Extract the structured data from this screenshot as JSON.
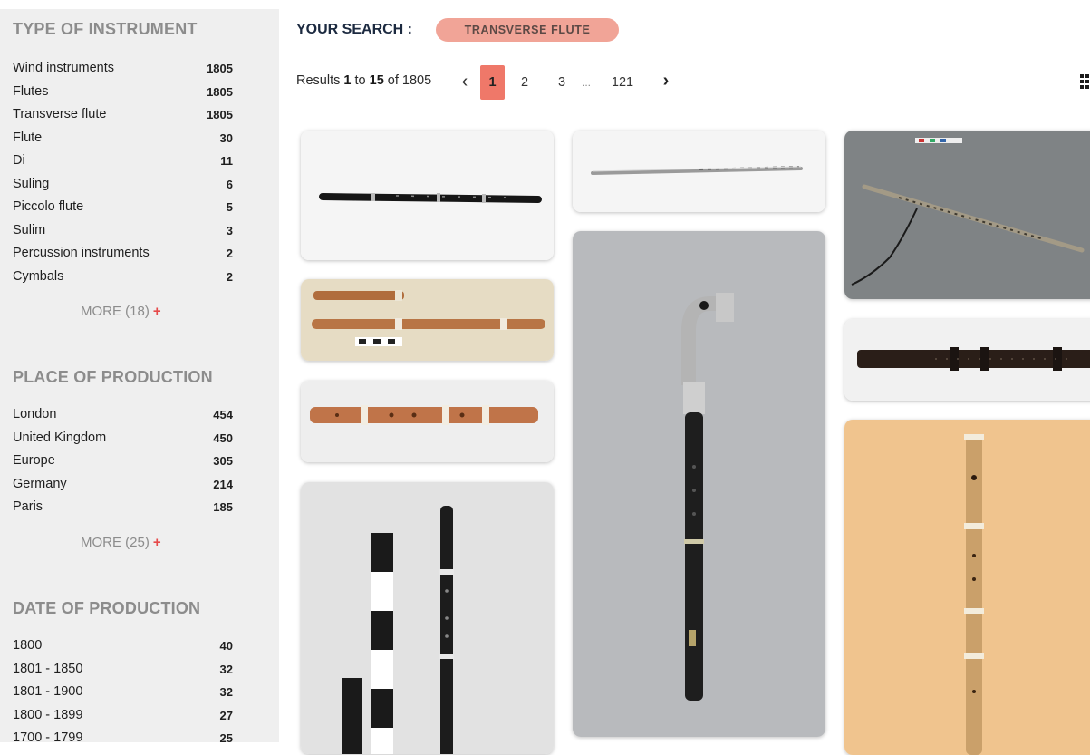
{
  "sidebar": {
    "instrument": {
      "title": "TYPE OF INSTRUMENT",
      "items": [
        {
          "label": "Wind instruments",
          "count": "1805"
        },
        {
          "label": "Flutes",
          "count": "1805"
        },
        {
          "label": "Transverse flute",
          "count": "1805"
        },
        {
          "label": "Flute",
          "count": "30"
        },
        {
          "label": "Di",
          "count": "11"
        },
        {
          "label": "Suling",
          "count": "6"
        },
        {
          "label": "Piccolo flute",
          "count": "5"
        },
        {
          "label": "Sulim",
          "count": "3"
        },
        {
          "label": "Percussion instruments",
          "count": "2"
        },
        {
          "label": "Cymbals",
          "count": "2"
        }
      ],
      "more": "MORE (18)",
      "more_icon": "+"
    },
    "place": {
      "title": "PLACE OF PRODUCTION",
      "items": [
        {
          "label": "London",
          "count": "454"
        },
        {
          "label": "United Kingdom",
          "count": "450"
        },
        {
          "label": "Europe",
          "count": "305"
        },
        {
          "label": "Germany",
          "count": "214"
        },
        {
          "label": "Paris",
          "count": "185"
        }
      ],
      "more": "MORE (25)",
      "more_icon": "+"
    },
    "date": {
      "title": "DATE OF PRODUCTION",
      "items": [
        {
          "label": "1800",
          "count": "40"
        },
        {
          "label": "1801 - 1850",
          "count": "32"
        },
        {
          "label": "1801 - 1900",
          "count": "32"
        },
        {
          "label": "1800 - 1899",
          "count": "27"
        },
        {
          "label": "1700 - 1799",
          "count": "25"
        }
      ]
    }
  },
  "search": {
    "label": "YOUR SEARCH :",
    "chip": "TRANSVERSE FLUTE"
  },
  "results": {
    "prefix": "Results ",
    "from": "1",
    "to_word": " to ",
    "to": "15",
    "of_word": " of ",
    "total": "1805"
  },
  "pagination": {
    "prev_icon": "‹",
    "pages": [
      "1",
      "2",
      "3"
    ],
    "ellipsis": "...",
    "last": "121",
    "next_icon": "›",
    "current": "1"
  },
  "icons": {
    "prev": "chevron-left-icon",
    "next": "chevron-right-icon",
    "grid": "grid-view-icon",
    "more": "plus-icon"
  },
  "colors": {
    "accent": "#ef7869",
    "chip_bg": "#f1a497",
    "sidebar_bg": "#efefef",
    "facet_title": "#8c8c8c",
    "more_plus": "#e64a4a"
  }
}
